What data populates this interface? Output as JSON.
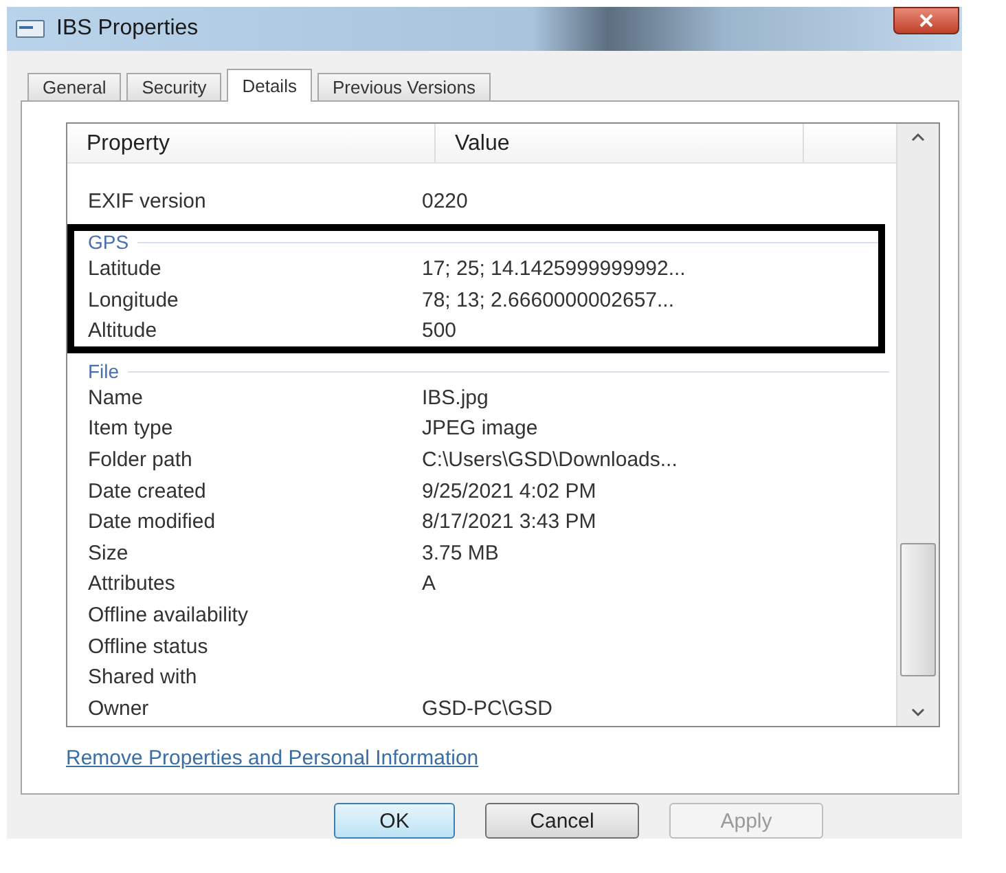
{
  "window": {
    "title": "IBS Properties"
  },
  "tabs": [
    {
      "label": "General",
      "selected": false
    },
    {
      "label": "Security",
      "selected": false
    },
    {
      "label": "Details",
      "selected": true
    },
    {
      "label": "Previous Versions",
      "selected": false
    }
  ],
  "table": {
    "columns": [
      "Property",
      "Value"
    ],
    "groups": [
      {
        "highlighted": false,
        "rows": [
          {
            "property": "EXIF version",
            "value": "0220"
          }
        ]
      },
      {
        "heading": "GPS",
        "highlighted": true,
        "rows": [
          {
            "property": "Latitude",
            "value": "17; 25; 14.1425999999992..."
          },
          {
            "property": "Longitude",
            "value": "78; 13; 2.6660000002657..."
          },
          {
            "property": "Altitude",
            "value": "500"
          }
        ]
      },
      {
        "heading": "File",
        "highlighted": false,
        "rows": [
          {
            "property": "Name",
            "value": "IBS.jpg"
          },
          {
            "property": "Item type",
            "value": "JPEG image"
          },
          {
            "property": "Folder path",
            "value": "C:\\Users\\GSD\\Downloads..."
          },
          {
            "property": "Date created",
            "value": "9/25/2021 4:02 PM"
          },
          {
            "property": "Date modified",
            "value": "8/17/2021 3:43 PM"
          },
          {
            "property": "Size",
            "value": "3.75 MB"
          },
          {
            "property": "Attributes",
            "value": "A"
          },
          {
            "property": "Offline availability"
          },
          {
            "property": "Offline status"
          },
          {
            "property": "Shared with"
          },
          {
            "property": "Owner",
            "value": "GSD-PC\\GSD"
          }
        ]
      }
    ]
  },
  "link": "Remove Properties and Personal Information",
  "buttons": [
    {
      "label": "OK",
      "kind": "default",
      "disabled": false
    },
    {
      "label": "Cancel",
      "kind": "normal",
      "disabled": false
    },
    {
      "label": "Apply",
      "kind": "normal",
      "disabled": true
    }
  ]
}
